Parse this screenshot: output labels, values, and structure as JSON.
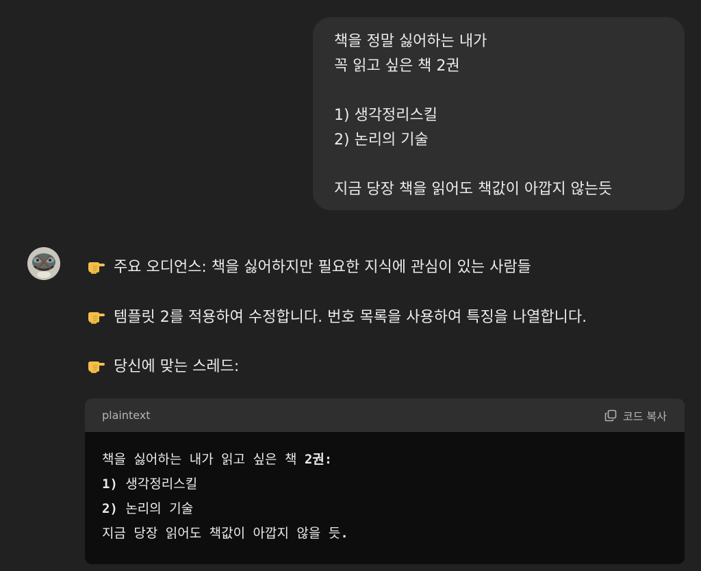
{
  "user_message": {
    "lines": [
      "책을 정말 싫어하는 내가",
      "꼭 읽고 싶은 책 2권",
      "",
      "1) 생각정리스킬",
      "2) 논리의 기술",
      "",
      "지금 당장 책을 읽어도 책값이 아깝지 않는듯"
    ]
  },
  "assistant": {
    "avatar_icon": "assistant-avatar",
    "bullets": [
      {
        "emoji": "pointing-hand-icon",
        "text": "주요 오디언스: 책을 싫어하지만 필요한 지식에 관심이 있는 사람들"
      },
      {
        "emoji": "pointing-hand-icon",
        "text": "템플릿 2를 적용하여 수정합니다. 번호 목록을 사용하여 특징을 나열합니다."
      },
      {
        "emoji": "pointing-hand-icon",
        "text": "당신에 맞는 스레드:"
      }
    ]
  },
  "code_block": {
    "language": "plaintext",
    "copy_label": "코드 복사",
    "copy_icon": "copy-icon",
    "lines": [
      {
        "text": "책을 싫어하는 내가 읽고 싶은 책 ",
        "bold": "2권:"
      },
      {
        "bold": "1)",
        "text": " 생각정리스킬"
      },
      {
        "bold": "2)",
        "text": " 논리의 기술"
      },
      {
        "text": "지금 당장 읽어도 책값이 아깝지 않을 듯",
        "bold": "."
      }
    ]
  },
  "colors": {
    "background": "#212121",
    "bubble": "#2f2f2f",
    "code_bg": "#0d0d0d"
  }
}
